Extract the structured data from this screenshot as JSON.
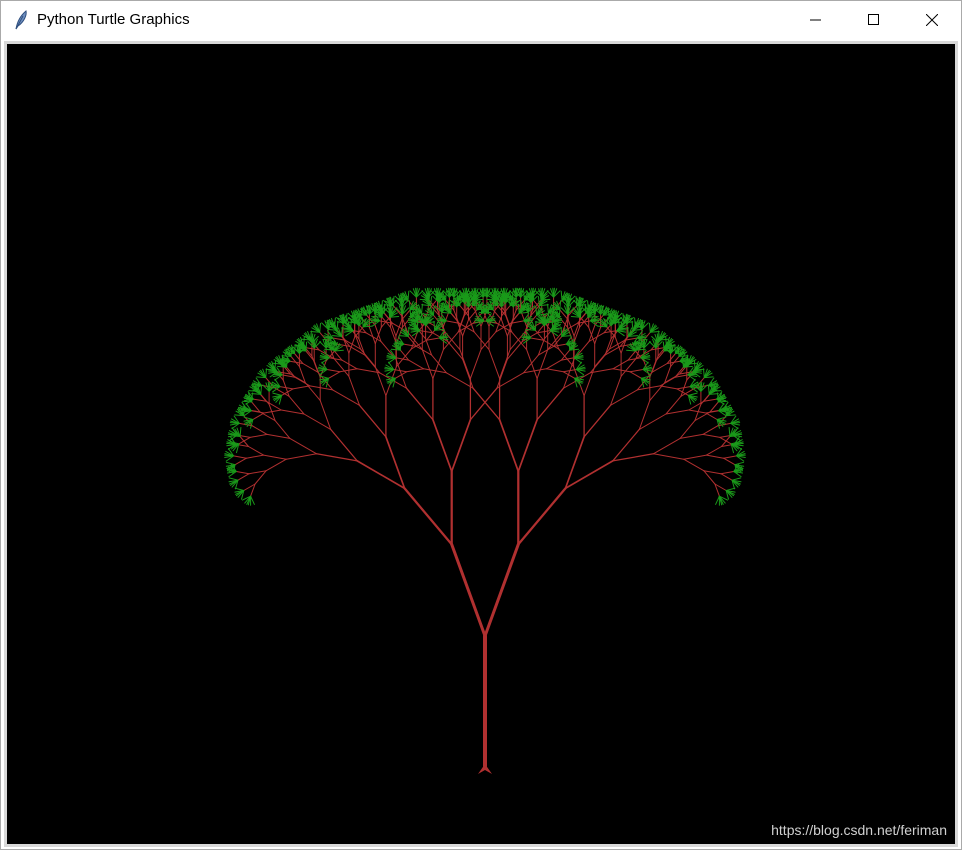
{
  "window": {
    "title": "Python Turtle Graphics",
    "icon": "feather-icon",
    "controls": {
      "minimize": "minimize-icon",
      "maximize": "maximize-icon",
      "close": "close-icon"
    }
  },
  "canvas": {
    "background": "#000000",
    "branch_color": "#b03030",
    "leaf_color": "#1a9a1a",
    "watermark": "https://blog.csdn.net/feriman"
  }
}
